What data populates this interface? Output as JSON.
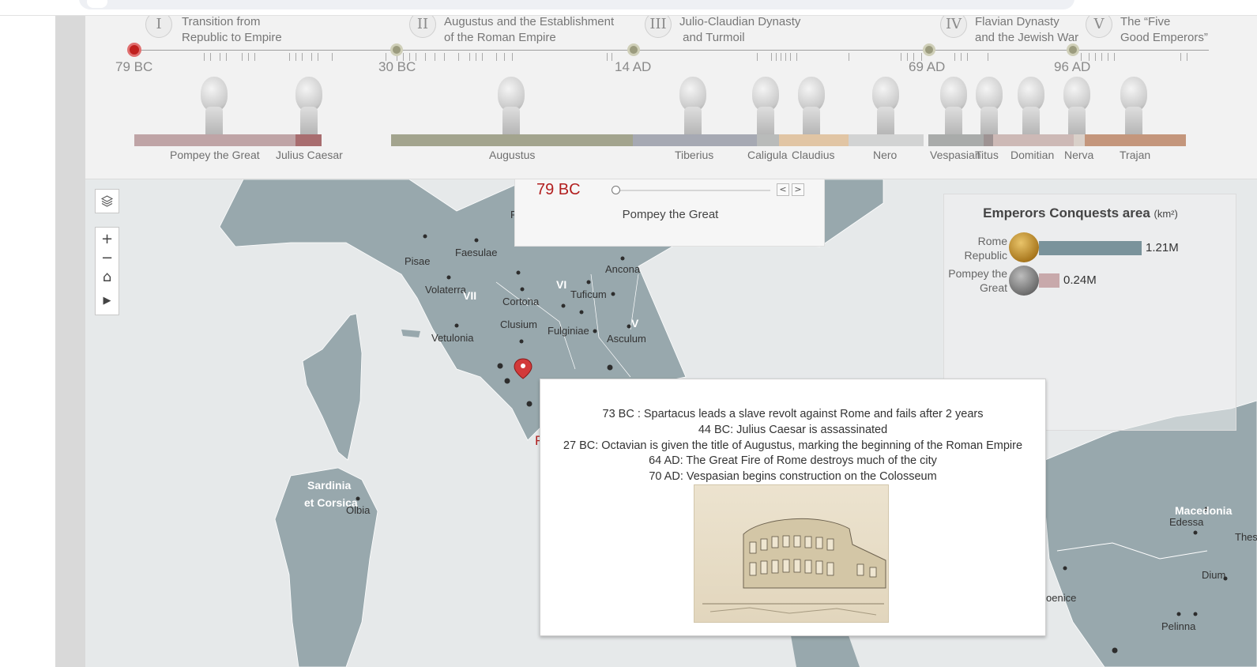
{
  "timeline": {
    "eras": [
      {
        "numeral": "I",
        "title": "Transition from\nRepublic to Empire"
      },
      {
        "numeral": "II",
        "title": "Augustus and the Establishment\nof the Roman Empire"
      },
      {
        "numeral": "III",
        "title": "Julio-Claudian Dynasty\n and Turmoil"
      },
      {
        "numeral": "IV",
        "title": "Flavian Dynasty\nand the Jewish War"
      },
      {
        "numeral": "V",
        "title": "The “Five\nGood Emperors”"
      }
    ],
    "years": [
      "79 BC",
      "30 BC",
      "14 AD",
      "69 AD",
      "96 AD"
    ],
    "active_year_index": 0,
    "rulers": [
      {
        "name": "Pompey the Great",
        "color": "#bfa4a6"
      },
      {
        "name": "Julius Caesar",
        "color": "#a86d6f"
      },
      {
        "name": "Augustus",
        "color": "#a3a48e"
      },
      {
        "name": "Tiberius",
        "color": "#a6a9b3"
      },
      {
        "name": "Caligula",
        "color": "#b9bbba"
      },
      {
        "name": "Claudius",
        "color": "#e1c5a4"
      },
      {
        "name": "Nero",
        "color": "#d2d3d3"
      },
      {
        "name": "Vespasian",
        "color": "#a9abaa"
      },
      {
        "name": "Titus",
        "color": "#9e9393"
      },
      {
        "name": "Domitian",
        "color": "#cdb9b6"
      },
      {
        "name": "Nerva",
        "color": "#d9d0c9"
      },
      {
        "name": "Trajan",
        "color": "#c4967c"
      }
    ]
  },
  "year_panel": {
    "current_year": "79 BC",
    "current_person": "Pompey the Great",
    "prev_symbol": "<",
    "next_symbol": ">"
  },
  "map": {
    "cities": [
      "Pisae",
      "Faesulae",
      "Ancona",
      "Volaterra",
      "Cortona",
      "Tuficum",
      "Clusium",
      "Fulginiae",
      "Asculum",
      "Vetulonia",
      "Olbia",
      "Edessa",
      "Thess",
      "Dium",
      "Pelinna",
      "oenice"
    ],
    "regions": [
      "VII",
      "VI",
      "V",
      "Sardinia",
      "et Corsica",
      "Macedonia"
    ],
    "partial_city": "F",
    "partial_red": "R",
    "controls": {
      "zoom_in": "+",
      "zoom_out": "−",
      "home": "⌂",
      "play": "▶"
    }
  },
  "conquest_chart": {
    "title": "Emperors Conquests area",
    "unit": "(km²)",
    "rows": [
      {
        "label": "Rome Republic",
        "value": 1.21,
        "display": "1.21M",
        "color": "#7a939b",
        "coin": "gold"
      },
      {
        "label": "Pompey the Great",
        "value": 0.24,
        "display": "0.24M",
        "color": "#c8a9ab",
        "coin": "silver"
      }
    ]
  },
  "tooltip": {
    "events": [
      "73 BC : Spartacus leads a slave revolt against Rome and fails after 2 years",
      "44 BC: Julius Caesar is assassinated",
      "27 BC:  Octavian is given the title of Augustus, marking the beginning of the Roman Empire",
      "64 AD: The Great Fire of Rome destroys much of the city",
      "70 AD:  Vespasian begins construction on the Colosseum"
    ],
    "image": "colosseum-sketch"
  },
  "colors": {
    "accent": "#b21f1f",
    "land": "#98a8ad",
    "sea": "#e6e9ea"
  }
}
